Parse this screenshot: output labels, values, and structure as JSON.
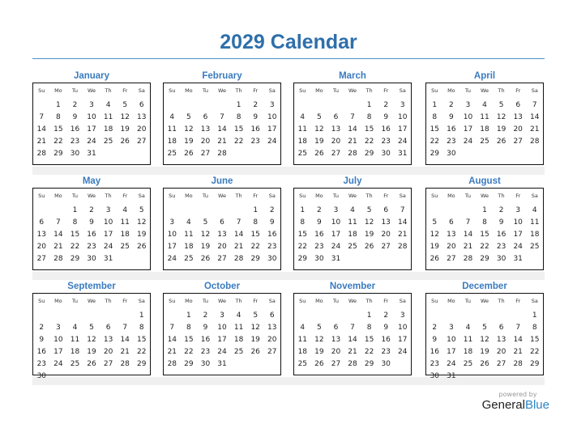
{
  "title": "2029 Calendar",
  "weekday_headers": [
    "Su",
    "Mo",
    "Tu",
    "We",
    "Th",
    "Fr",
    "Sa"
  ],
  "months": [
    {
      "name": "January",
      "start": 1,
      "days": 31
    },
    {
      "name": "February",
      "start": 4,
      "days": 28
    },
    {
      "name": "March",
      "start": 4,
      "days": 31
    },
    {
      "name": "April",
      "start": 0,
      "days": 30
    },
    {
      "name": "May",
      "start": 2,
      "days": 31
    },
    {
      "name": "June",
      "start": 5,
      "days": 30
    },
    {
      "name": "July",
      "start": 0,
      "days": 31
    },
    {
      "name": "August",
      "start": 3,
      "days": 31
    },
    {
      "name": "September",
      "start": 6,
      "days": 30
    },
    {
      "name": "October",
      "start": 1,
      "days": 31
    },
    {
      "name": "November",
      "start": 4,
      "days": 30
    },
    {
      "name": "December",
      "start": 6,
      "days": 31
    }
  ],
  "branding": {
    "powered_by": "powered by",
    "name_part1": "General",
    "name_part2": "Blue"
  },
  "colors": {
    "title": "#2e6faa",
    "month_name": "#3a7bbf",
    "brand_blue": "#2d86c6"
  }
}
